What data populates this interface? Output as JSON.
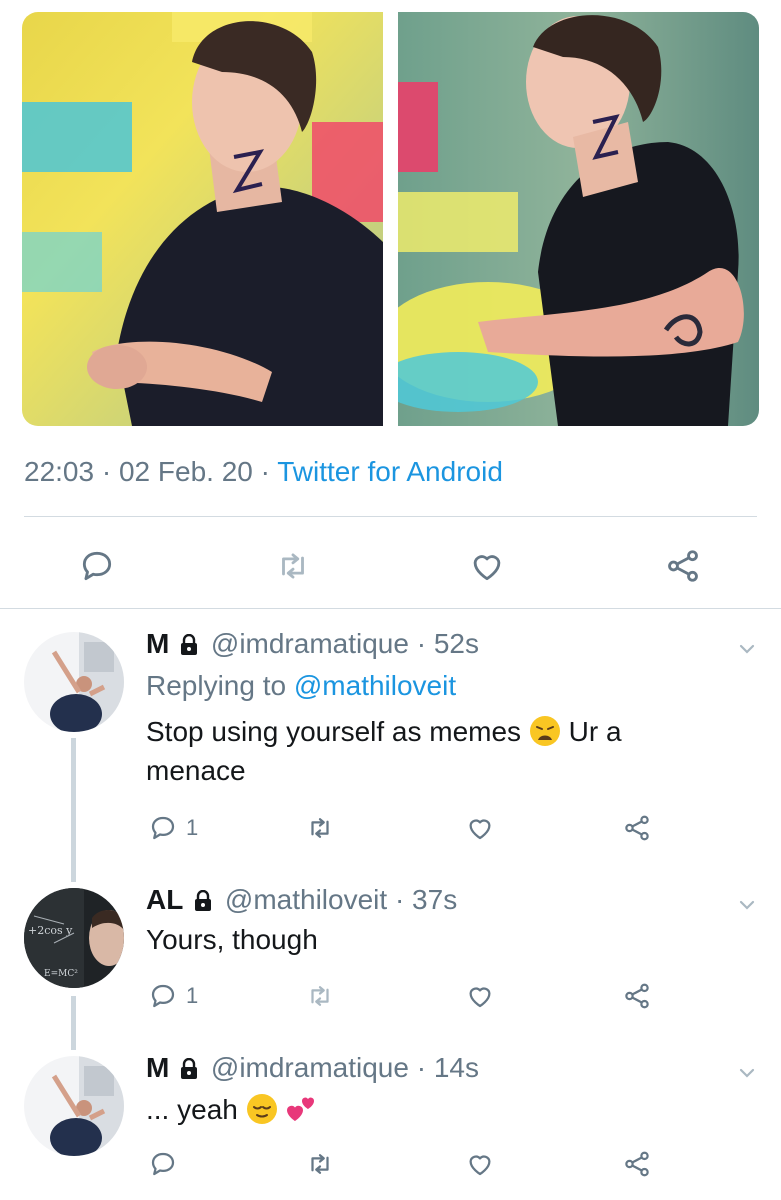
{
  "tweet": {
    "time": "22:03",
    "date": "02 Feb. 20",
    "source": "Twitter for Android",
    "media": [
      {
        "alt_icon": "photo-man-running-left"
      },
      {
        "alt_icon": "photo-man-running-right"
      }
    ],
    "actions": [
      "reply-icon",
      "retweet-icon",
      "like-icon",
      "share-icon"
    ]
  },
  "replies": [
    {
      "name": "M",
      "handle": "@imdramatique",
      "separator": "·",
      "time": "52s",
      "replying_prefix": "Replying to",
      "replying_to": "@mathiloveit",
      "text_before_emoji": "Stop using yourself as memes",
      "text_after_emoji": "Ur a menace",
      "emoji": "weary-face",
      "reply_count": "1"
    },
    {
      "name": "AL",
      "handle": "@mathiloveit",
      "separator": "·",
      "time": "37s",
      "text": "Yours, though",
      "reply_count": "1"
    },
    {
      "name": "M",
      "handle": "@imdramatique",
      "separator": "·",
      "time": "14s",
      "text": "... yeah",
      "emoji": [
        "relieved-face",
        "two-hearts"
      ]
    }
  ],
  "colors": {
    "link": "#1b95e0",
    "secondary_text": "#657786",
    "primary_text": "#14171a",
    "icon": "#657786",
    "divider": "#d3dbe1",
    "thread_line": "#ccd6dd"
  }
}
